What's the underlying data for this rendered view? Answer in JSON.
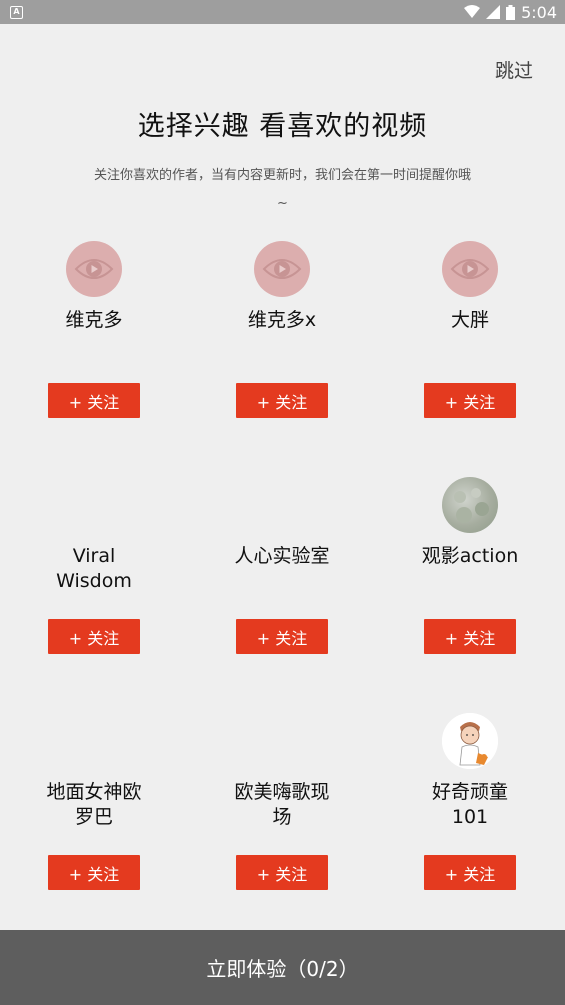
{
  "status_bar": {
    "time": "5:04",
    "notification_icon": "a-icon"
  },
  "header": {
    "skip_label": "跳过",
    "title": "选择兴趣 看喜欢的视频",
    "subtitle_line1": "关注你喜欢的作者，当有内容更新时，我们会在第一时间提醒你哦",
    "subtitle_line2": "~"
  },
  "authors": [
    {
      "name": "维克多",
      "avatar": "eye-icon",
      "follow_label": "+ 关注"
    },
    {
      "name": "维克多x",
      "avatar": "eye-icon",
      "follow_label": "+ 关注"
    },
    {
      "name": "大胖",
      "avatar": "eye-icon",
      "follow_label": "+ 关注"
    },
    {
      "name": "Viral\nWisdom",
      "avatar": "none",
      "follow_label": "+ 关注"
    },
    {
      "name": "人心实验室",
      "avatar": "none",
      "follow_label": "+ 关注"
    },
    {
      "name": "观影action",
      "avatar": "photo",
      "follow_label": "+ 关注"
    },
    {
      "name": "地面女神欧\n罗巴",
      "avatar": "none",
      "follow_label": "+ 关注"
    },
    {
      "name": "欧美嗨歌现\n场",
      "avatar": "none",
      "follow_label": "+ 关注"
    },
    {
      "name": "好奇顽童\n101",
      "avatar": "cartoon",
      "follow_label": "+ 关注"
    }
  ],
  "footer": {
    "cta_label": "立即体验（0/2）"
  },
  "colors": {
    "accent": "#e43a1f",
    "footer_bg": "#5e5e5e",
    "page_bg": "#efefef"
  }
}
